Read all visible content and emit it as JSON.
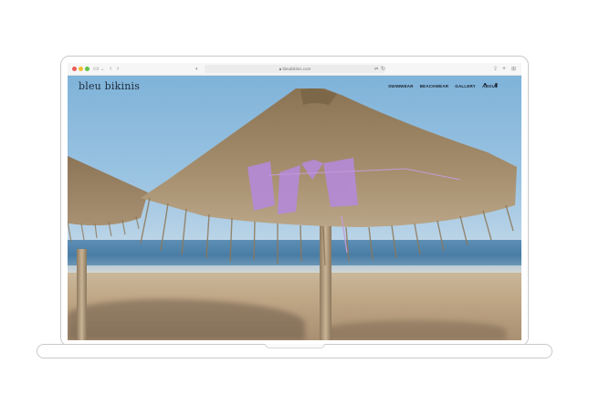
{
  "browser": {
    "url": "bleubikinis.com",
    "icons": {
      "sidebar": "sidebar-icon",
      "back": "chevron-left-icon",
      "forward": "chevron-right-icon",
      "shield": "shield-icon",
      "translate": "translate-icon",
      "reload": "reload-icon",
      "share": "share-icon",
      "new_tab": "plus-icon",
      "tabs": "tab-overview-icon"
    }
  },
  "site": {
    "logo": "bleu bikinis",
    "nav": [
      {
        "label": "SWIMWEAR"
      },
      {
        "label": "BEACHWEAR"
      },
      {
        "label": "GALLERY"
      },
      {
        "label": "ABOUT"
      }
    ],
    "icons": {
      "account": "user-icon",
      "bag": "shopping-bag-icon"
    }
  },
  "colors": {
    "sky": "#8fbbe0",
    "sea": "#4a7da5",
    "sand": "#c3ab8b",
    "thatch": "#9a8462",
    "bikini": "#b58ad6"
  }
}
